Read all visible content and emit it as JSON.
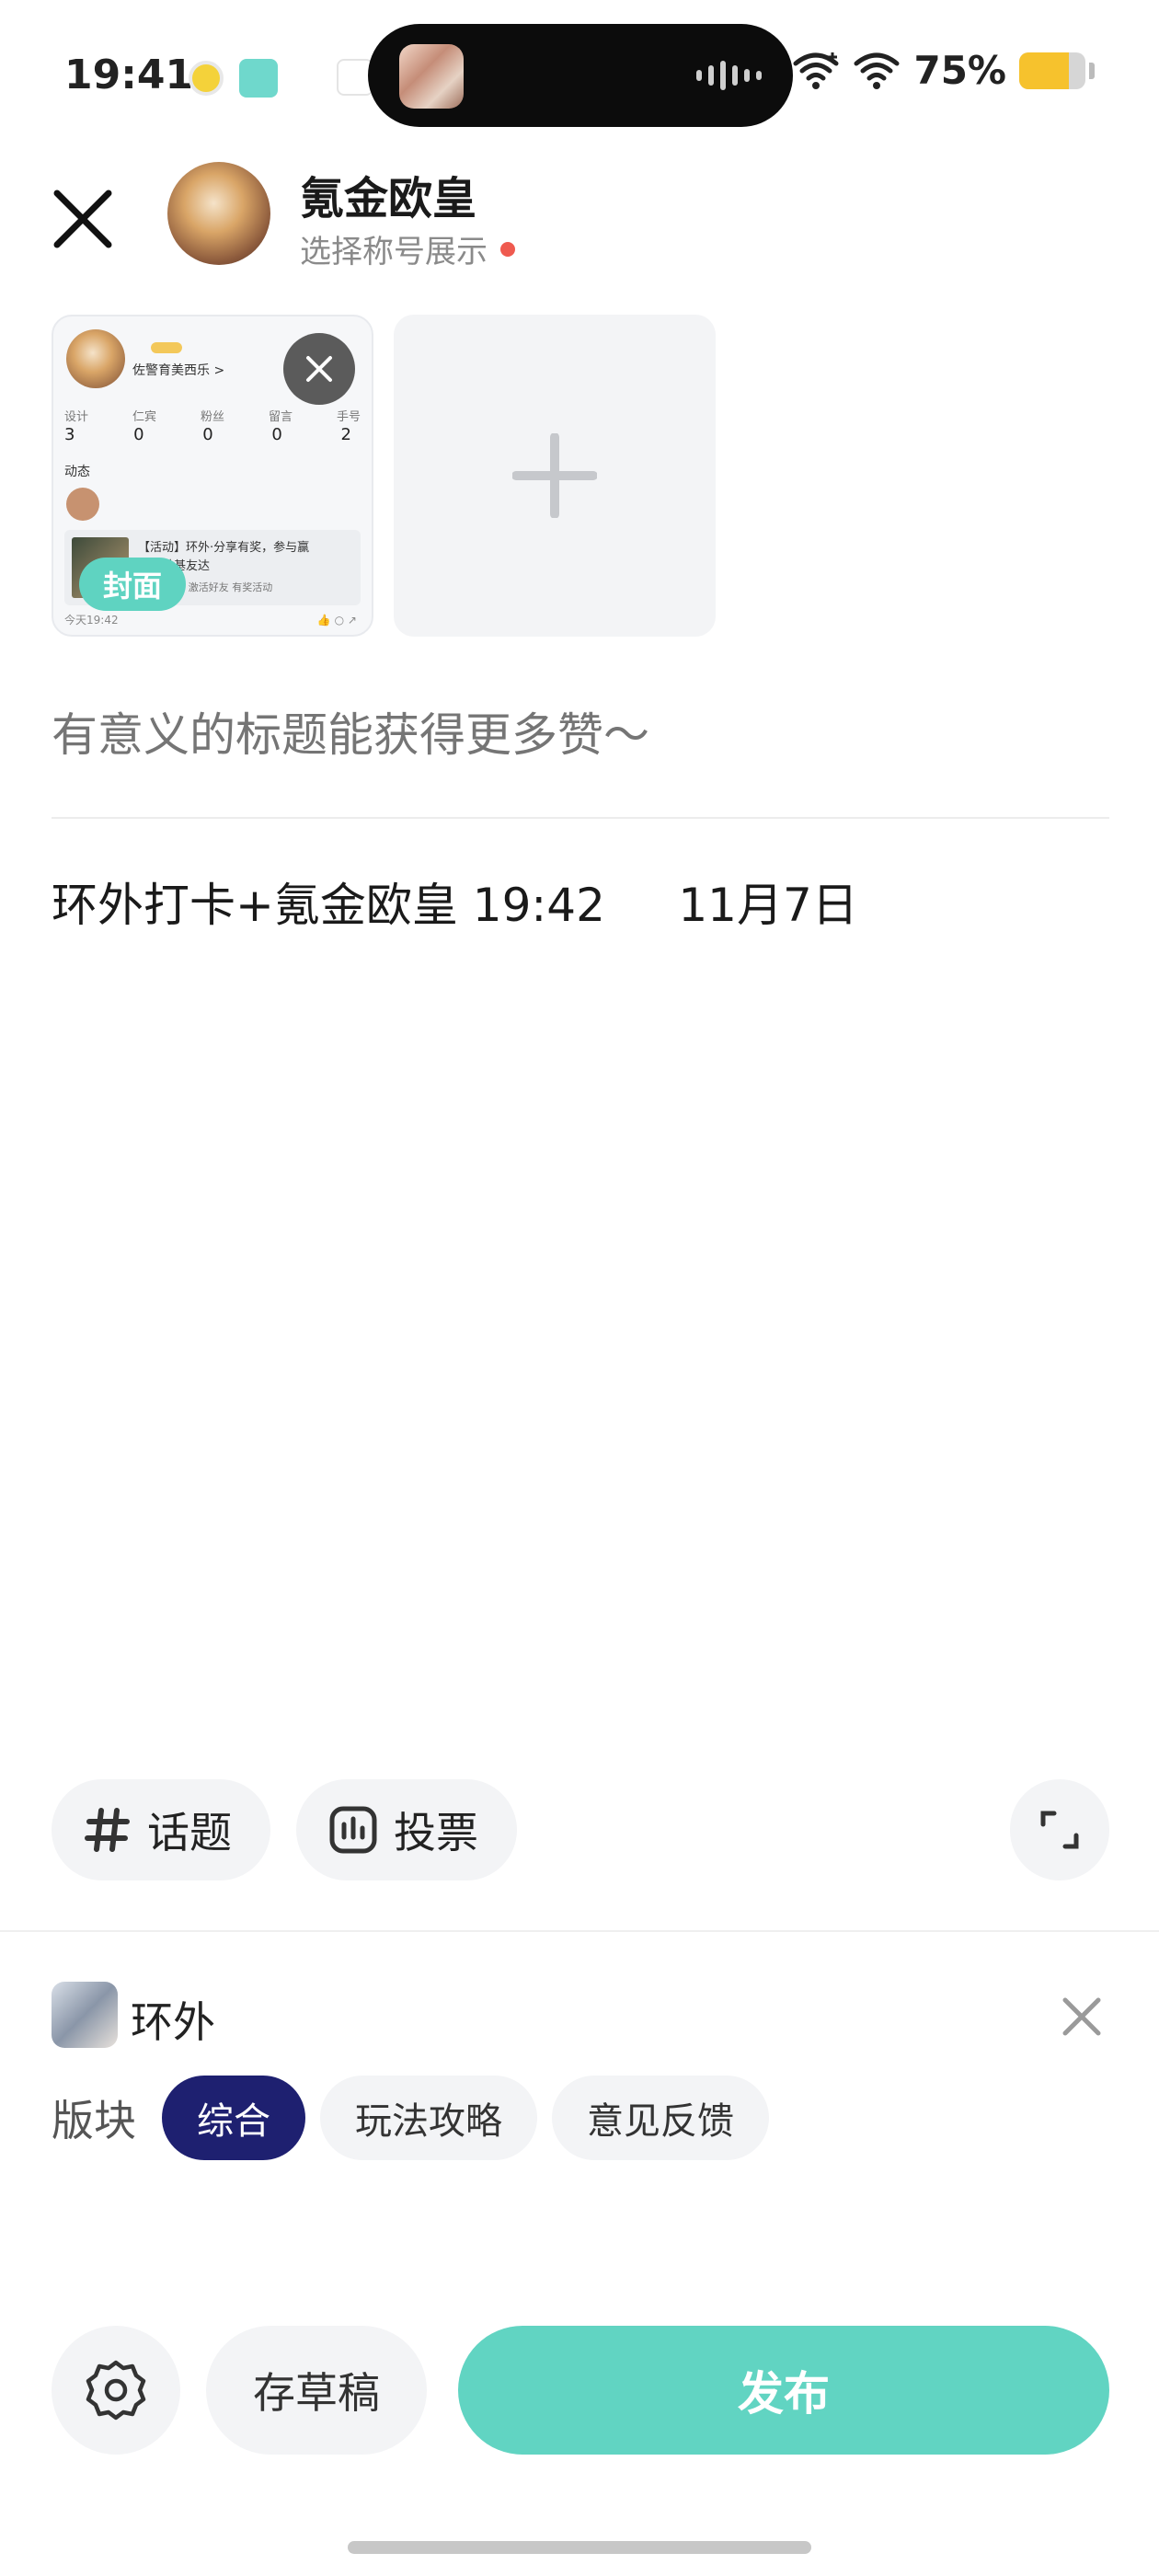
{
  "status_bar": {
    "time": "19:41",
    "battery_percent_text": "75%",
    "battery_level": 0.75,
    "icons": [
      "notification-app-icon",
      "notification-app-icon",
      "dynamic-island-media",
      "wifi-icon",
      "wifi-icon",
      "battery-icon"
    ]
  },
  "header": {
    "username": "氪金欧皇",
    "subtitle": "选择称号展示",
    "close_icon": "close-icon"
  },
  "media": {
    "thumbnail": {
      "cover_label": "封面",
      "preview": {
        "nickname": "佐警育美西乐 >",
        "stats_labels": [
          "设计",
          "仁宾",
          "粉丝",
          "留言",
          "手号"
        ],
        "stats_values": [
          "3",
          "0",
          "0",
          "0",
          "2"
        ],
        "section": "动态",
        "post_text": "【活动】环外·分享有奖，参与赢",
        "post_sub": "取和林基友达",
        "post_meta": "已主活动 | 激活好友 有奖活动",
        "post_time": "今天19:42"
      }
    },
    "add_icon": "plus-icon",
    "remove_icon": "close-icon"
  },
  "editor": {
    "title_placeholder": "有意义的标题能获得更多赞～",
    "body_text": "环外打卡+氪金欧皇 19:42     11月7日"
  },
  "toolbar": {
    "topic_label": "话题",
    "topic_icon": "hashtag-icon",
    "vote_label": "投票",
    "vote_icon": "poll-icon",
    "expand_icon": "expand-icon"
  },
  "game": {
    "name": "环外",
    "board_label": "版块",
    "boards": [
      {
        "label": "综合",
        "active": true
      },
      {
        "label": "玩法攻略",
        "active": false
      },
      {
        "label": "意见反馈",
        "active": false
      }
    ]
  },
  "bottom": {
    "settings_icon": "gear-icon",
    "draft_label": "存草稿",
    "publish_label": "发布"
  },
  "colors": {
    "accent": "#61d4c2",
    "board_active": "#1e2070",
    "red_dot": "#ef5a4f"
  }
}
